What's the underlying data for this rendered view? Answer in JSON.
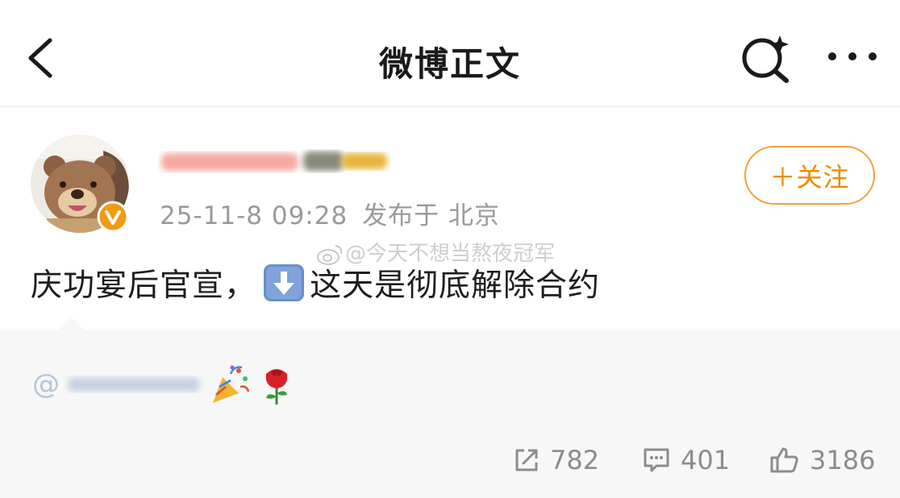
{
  "nav": {
    "title": "微博正文",
    "back_icon": "chevron-left-icon",
    "search_icon": "ai-search-icon",
    "more_icon": "more-dots-icon"
  },
  "post": {
    "timestamp": "25-11-8 09:28",
    "location": "发布于 北京",
    "follow_label": "＋关注",
    "text_before": "庆功宴后官宣，",
    "text_after": "这天是彻底解除合约",
    "watermark": "@今天不想当熬夜冠军"
  },
  "repost": {
    "at": "@"
  },
  "actions": {
    "repost_count": "782",
    "comment_count": "401",
    "like_count": "3186"
  },
  "colors": {
    "accent_orange": "#f08a00",
    "follow_border": "#f0a040",
    "muted_text": "#9a9a9a",
    "repost_bg": "#f7f7f7"
  }
}
